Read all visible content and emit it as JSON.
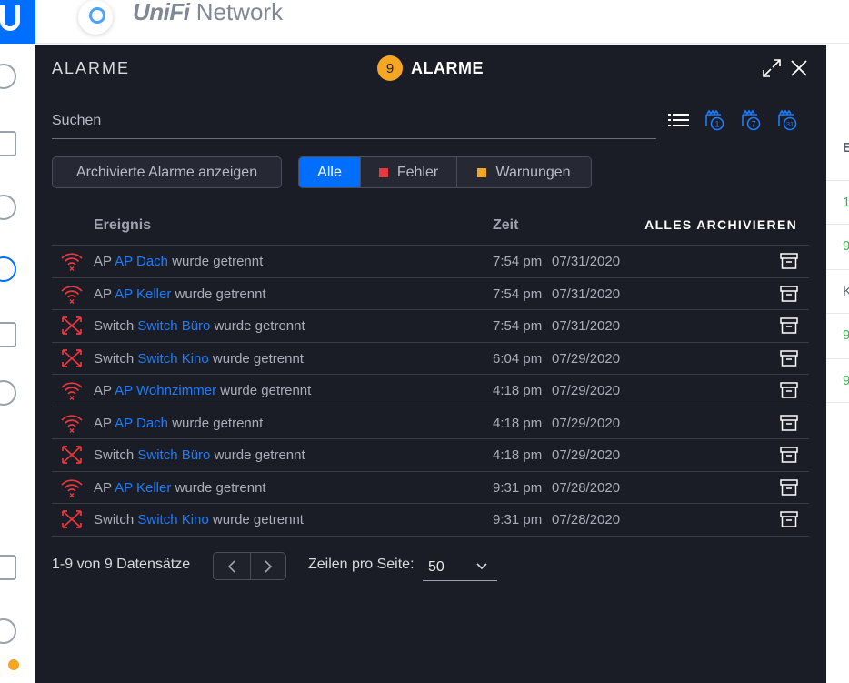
{
  "app": {
    "brand_prefix": "UniFi",
    "brand_suffix": " Network"
  },
  "background_table": {
    "header": "E",
    "cells": [
      "1",
      "9",
      "K",
      "9",
      "9"
    ]
  },
  "modal": {
    "label": "ALARME",
    "title": "ALARME",
    "count": "9",
    "search_placeholder": "Suchen",
    "archived_button": "Archivierte Alarme anzeigen",
    "filters": [
      {
        "label": "Alle",
        "active": true
      },
      {
        "label": "Fehler",
        "color": "#e8383d"
      },
      {
        "label": "Warnungen",
        "color": "#f5a623"
      }
    ],
    "columns": {
      "event": "Ereignis",
      "time": "Zeit"
    },
    "archive_all": "ALLES ARCHIVIEREN",
    "rows": [
      {
        "type": "ap",
        "icon": "wifi-disconnected-icon",
        "prefix": "AP",
        "device": "AP Dach",
        "suffix": "wurde getrennt",
        "time": "7:54 pm",
        "date": "07/31/2020"
      },
      {
        "type": "ap",
        "icon": "wifi-disconnected-icon",
        "prefix": "AP",
        "device": "AP Keller",
        "suffix": "wurde getrennt",
        "time": "7:54 pm",
        "date": "07/31/2020"
      },
      {
        "type": "switch",
        "icon": "switch-disconnected-icon",
        "prefix": "Switch",
        "device": "Switch Büro",
        "suffix": "wurde getrennt",
        "time": "7:54 pm",
        "date": "07/31/2020"
      },
      {
        "type": "switch",
        "icon": "switch-disconnected-icon",
        "prefix": "Switch",
        "device": "Switch Kino",
        "suffix": "wurde getrennt",
        "time": "6:04 pm",
        "date": "07/29/2020"
      },
      {
        "type": "ap",
        "icon": "wifi-disconnected-icon",
        "prefix": "AP",
        "device": "AP Wohnzimmer",
        "suffix": "wurde getrennt",
        "time": "4:18 pm",
        "date": "07/29/2020"
      },
      {
        "type": "ap",
        "icon": "wifi-disconnected-icon",
        "prefix": "AP",
        "device": "AP Dach",
        "suffix": "wurde getrennt",
        "time": "4:18 pm",
        "date": "07/29/2020"
      },
      {
        "type": "switch",
        "icon": "switch-disconnected-icon",
        "prefix": "Switch",
        "device": "Switch Büro",
        "suffix": "wurde getrennt",
        "time": "4:18 pm",
        "date": "07/29/2020"
      },
      {
        "type": "ap",
        "icon": "wifi-disconnected-icon",
        "prefix": "AP",
        "device": "AP Keller",
        "suffix": "wurde getrennt",
        "time": "9:31 pm",
        "date": "07/28/2020"
      },
      {
        "type": "switch",
        "icon": "switch-disconnected-icon",
        "prefix": "Switch",
        "device": "Switch Kino",
        "suffix": "wurde getrennt",
        "time": "9:31 pm",
        "date": "07/28/2020"
      }
    ],
    "pagination": {
      "summary": "1-9 von 9 Datensätze",
      "rows_per_page_label": "Zeilen pro Seite:",
      "rows_per_page": "50"
    }
  },
  "colors": {
    "accent": "#006fff",
    "link": "#1a7dff",
    "error": "#e8383d",
    "warning": "#f5a623",
    "modal_bg": "#1b1d26"
  }
}
